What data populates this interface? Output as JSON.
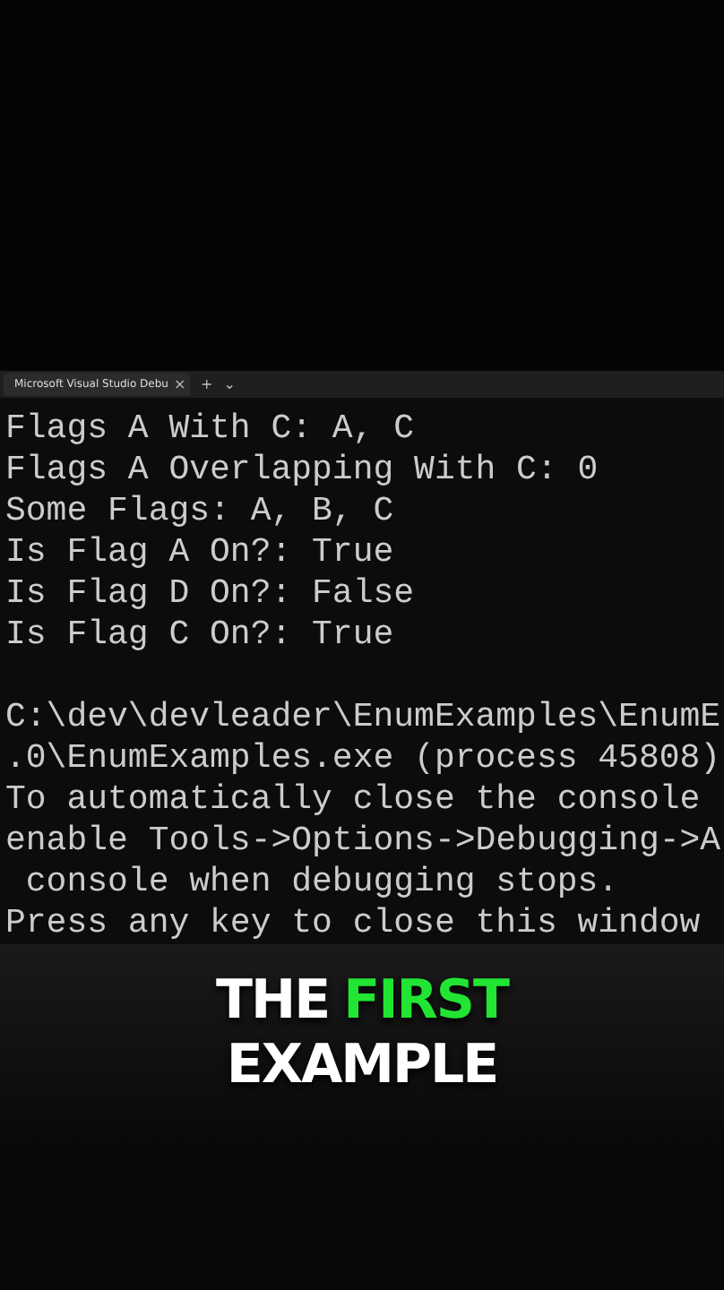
{
  "tab": {
    "title": "Microsoft Visual Studio Debu",
    "close": "×",
    "add": "+",
    "dropdown": "⌄"
  },
  "console": {
    "output": [
      "Flags A With C: A, C",
      "Flags A Overlapping With C: 0",
      "Some Flags: A, B, C",
      "Is Flag A On?: True",
      "Is Flag D On?: False",
      "Is Flag C On?: True"
    ],
    "exit_message": [
      "C:\\dev\\devleader\\EnumExamples\\EnumE",
      ".0\\EnumExamples.exe (process 45808)",
      "To automatically close the console",
      "enable Tools->Options->Debugging->A",
      " console when debugging stops.",
      "Press any key to close this window"
    ]
  },
  "caption": [
    {
      "words": [
        {
          "text": "THE",
          "highlight": false
        },
        {
          "text": "FIRST",
          "highlight": true
        }
      ]
    },
    {
      "words": [
        {
          "text": "EXAMPLE",
          "highlight": false
        }
      ]
    }
  ]
}
